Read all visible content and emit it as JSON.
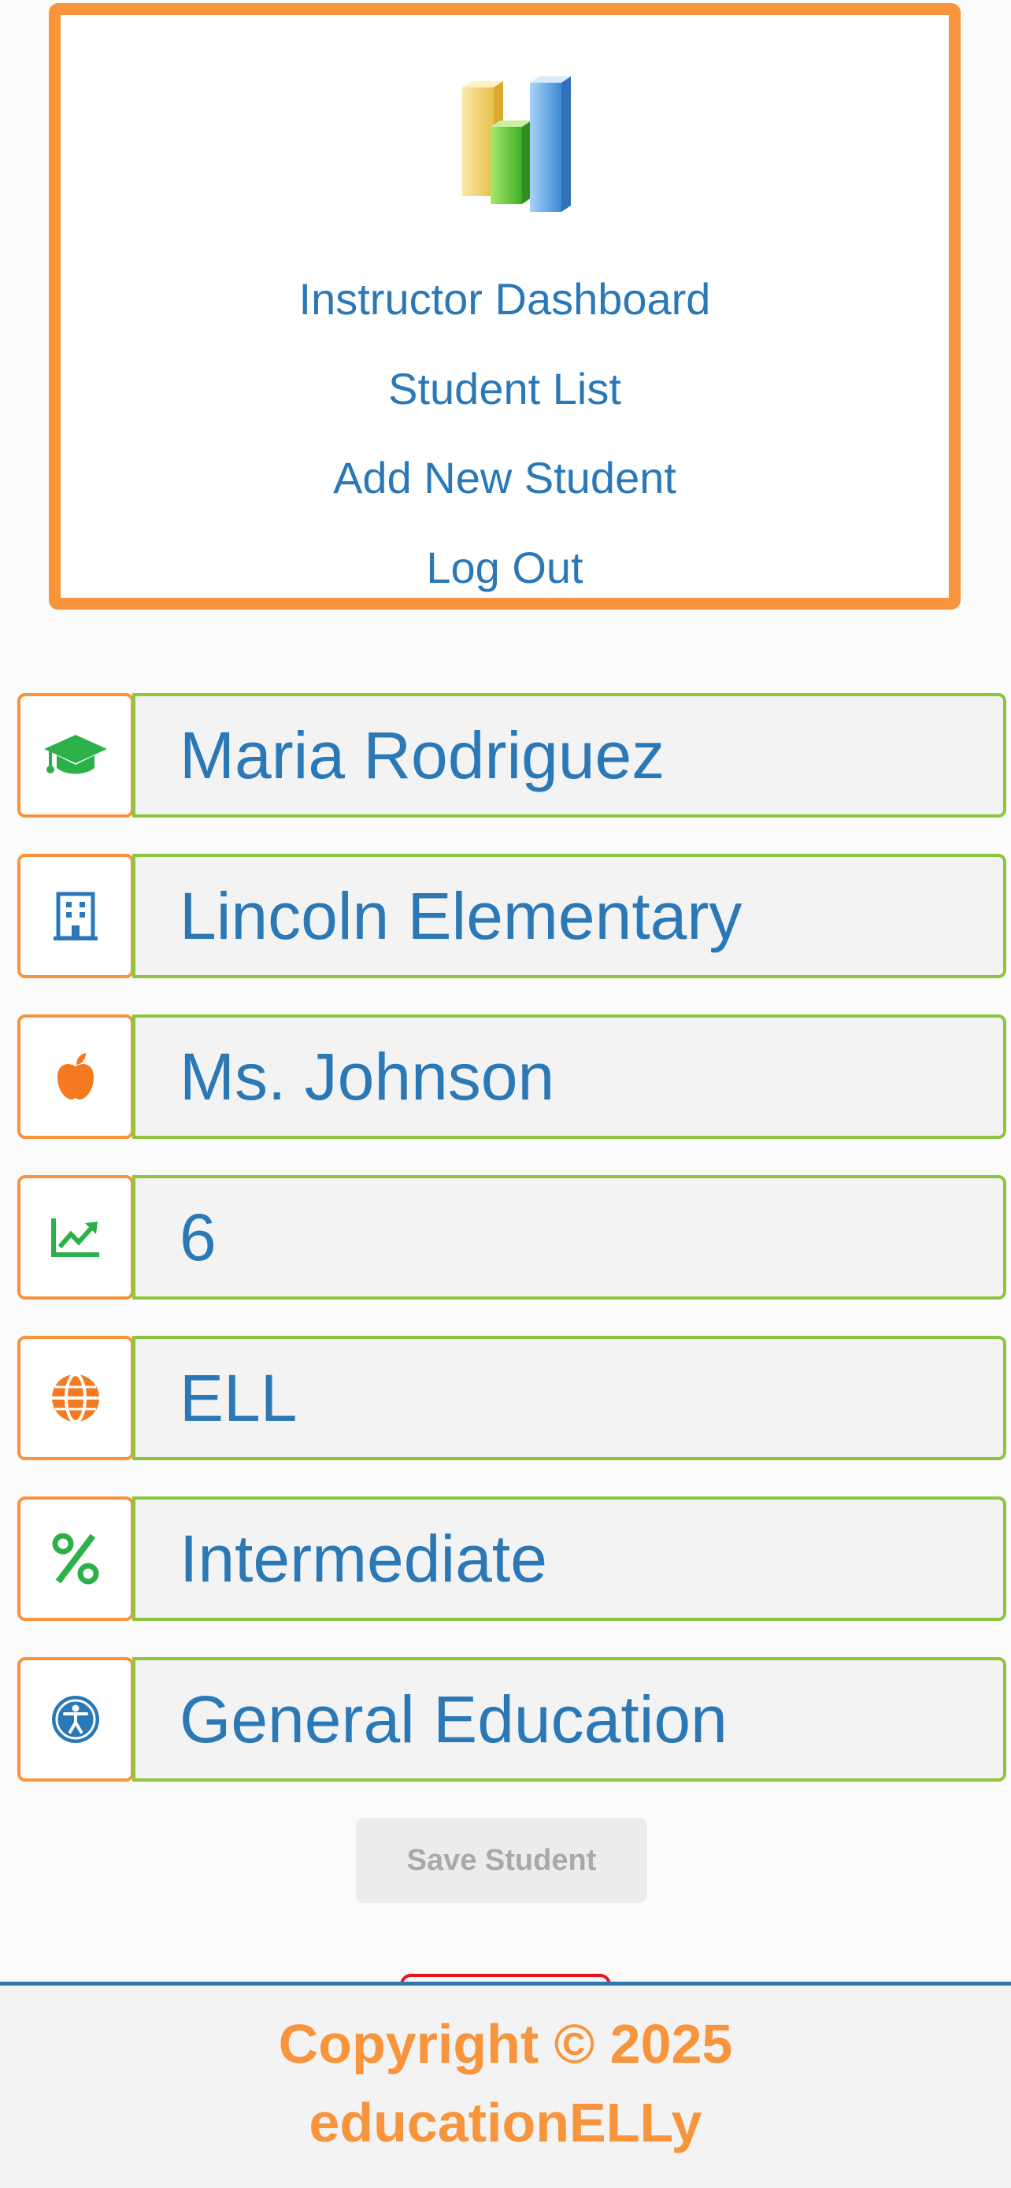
{
  "nav": {
    "logo_icon": "bar-chart-logo-icon",
    "links": [
      {
        "label": "Instructor Dashboard"
      },
      {
        "label": "Student List"
      },
      {
        "label": "Add New Student"
      },
      {
        "label": "Log Out"
      }
    ]
  },
  "form": {
    "fields": [
      {
        "icon": "graduation-cap-icon",
        "icon_color": "#2bb04a",
        "value": "Maria Rodriguez"
      },
      {
        "icon": "school-building-icon",
        "icon_color": "#2b78b7",
        "value": "Lincoln Elementary"
      },
      {
        "icon": "apple-icon",
        "icon_color": "#f47920",
        "value": "Ms. Johnson"
      },
      {
        "icon": "trend-chart-icon",
        "icon_color": "#2bb04a",
        "value": "6"
      },
      {
        "icon": "globe-icon",
        "icon_color": "#f47920",
        "value": "ELL"
      },
      {
        "icon": "percent-icon",
        "icon_color": "#2bb04a",
        "value": "Intermediate"
      },
      {
        "icon": "accessibility-icon",
        "icon_color": "#2b78b7",
        "value": "General Education"
      }
    ],
    "save_label": "Save Student"
  },
  "footer": {
    "line1": "Copyright © 2025",
    "line2": "educationELLy"
  },
  "colors": {
    "orange": "#f7943c",
    "green": "#8cc63f",
    "blue": "#2b78b7",
    "red": "#e8141c"
  }
}
